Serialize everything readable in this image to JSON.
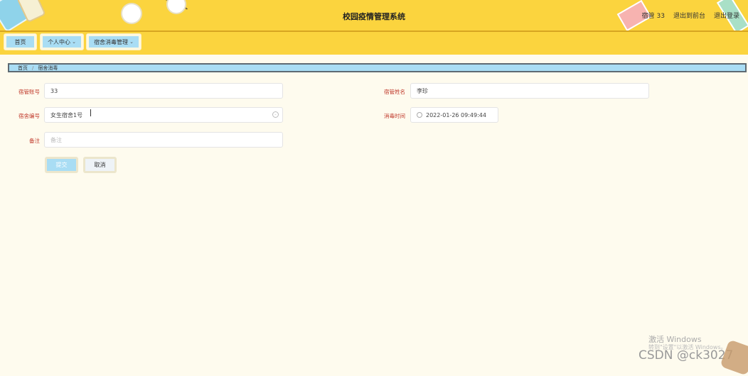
{
  "header": {
    "title": "校园疫情管理系统",
    "user_label": "宿管 33",
    "back_to_front": "退出到前台",
    "logout": "退出登录"
  },
  "nav": {
    "items": [
      {
        "label": "首页"
      },
      {
        "label": "个人中心"
      },
      {
        "label": "宿舍消毒管理"
      }
    ]
  },
  "breadcrumb": {
    "home": "首页",
    "separator": "/",
    "current": "宿舍消毒"
  },
  "form": {
    "account_label": "宿管账号",
    "account_value": "33",
    "name_label": "宿管姓名",
    "name_value": "李珍",
    "dorm_label": "宿舍编号",
    "dorm_value": "女生宿舍1号",
    "time_label": "消毒时间",
    "time_value": "2022-01-26 09:49:44",
    "remark_label": "备注",
    "remark_placeholder": "备注",
    "submit_label": "提交",
    "cancel_label": "取消"
  },
  "watermark": {
    "activate_line1": "激活 Windows",
    "activate_line2": "转到\"设置\"以激活 Windows。",
    "csdn": "CSDN @ck3027"
  }
}
